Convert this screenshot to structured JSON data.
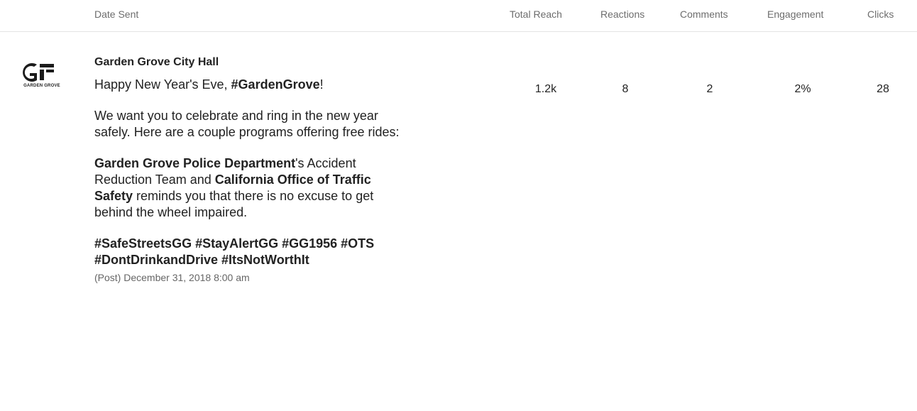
{
  "table": {
    "columns": {
      "date_sent": "Date Sent",
      "total_reach": "Total Reach",
      "reactions": "Reactions",
      "comments": "Comments",
      "engagement": "Engagement",
      "clicks": "Clicks"
    }
  },
  "post": {
    "logo_icon": "garden-grove-logo",
    "logo_caption": "GARDEN GROVE",
    "author": "Garden Grove City Hall",
    "greeting_text": "Happy New Year's Eve, ",
    "greeting_tag": "#GardenGrove",
    "greeting_end": "!",
    "para2": "We want you to celebrate and ring in the new year safely. Here are a couple programs offering free rides:",
    "para3_bold1": "Garden Grove Police Department",
    "para3_text1": "'s Accident Reduction Team and ",
    "para3_bold2": "California Office of Traffic Safety",
    "para3_text2": " reminds you that there is no excuse to get behind the wheel impaired.",
    "hashtags": "#SafeStreetsGG #StayAlertGG #GG1956 #OTS #DontDrinkandDrive #ItsNotWorthIt",
    "meta": "(Post) December 31, 2018 8:00 am"
  },
  "metrics": {
    "total_reach": "1.2k",
    "reactions": "8",
    "comments": "2",
    "engagement": "2%",
    "clicks": "28"
  }
}
